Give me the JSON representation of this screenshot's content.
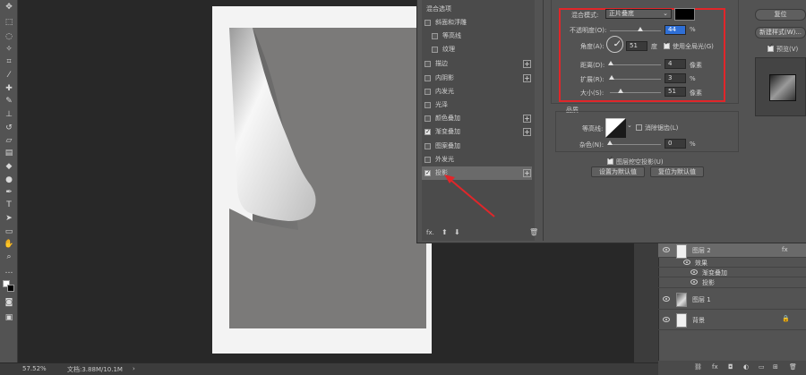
{
  "status": {
    "zoom": "57.52%",
    "doc": "文档:3.88M/10.1M"
  },
  "dialog": {
    "styles": [
      {
        "label": "混合选项",
        "checkbox": false,
        "plus": false,
        "checked": false
      },
      {
        "label": "斜面和浮雕",
        "checkbox": true,
        "plus": false,
        "checked": false
      },
      {
        "label": "等高线",
        "checkbox": true,
        "plus": false,
        "checked": false,
        "sub": true
      },
      {
        "label": "纹理",
        "checkbox": true,
        "plus": false,
        "checked": false,
        "sub": true
      },
      {
        "label": "描边",
        "checkbox": true,
        "plus": true,
        "checked": false
      },
      {
        "label": "内阴影",
        "checkbox": true,
        "plus": true,
        "checked": false
      },
      {
        "label": "内发光",
        "checkbox": true,
        "plus": false,
        "checked": false
      },
      {
        "label": "光泽",
        "checkbox": true,
        "plus": false,
        "checked": false
      },
      {
        "label": "颜色叠加",
        "checkbox": true,
        "plus": true,
        "checked": false
      },
      {
        "label": "渐变叠加",
        "checkbox": true,
        "plus": true,
        "checked": true
      },
      {
        "label": "图案叠加",
        "checkbox": true,
        "plus": false,
        "checked": false
      },
      {
        "label": "外发光",
        "checkbox": true,
        "plus": false,
        "checked": false
      },
      {
        "label": "投影",
        "checkbox": true,
        "plus": true,
        "checked": true,
        "selected": true
      }
    ],
    "fx_label": "fx.",
    "structure": {
      "blend_mode_label": "混合模式:",
      "blend_mode_value": "正片叠底",
      "shadow_color": "#000000",
      "opacity_label": "不透明度(O):",
      "opacity_value": "44",
      "opacity_unit": "%",
      "angle_label": "角度(A):",
      "angle_value": "51",
      "angle_unit": "度",
      "global_light_label": "使用全局光(G)",
      "distance_label": "距离(D):",
      "distance_value": "4",
      "distance_unit": "像素",
      "spread_label": "扩展(R):",
      "spread_value": "3",
      "spread_unit": "%",
      "size_label": "大小(S):",
      "size_value": "51",
      "size_unit": "像素"
    },
    "quality": {
      "section_label": "品质",
      "contour_label": "等高线:",
      "anti_alias_label": "消除锯齿(L)",
      "noise_label": "杂色(N):",
      "noise_value": "0",
      "noise_unit": "%"
    },
    "knockout_label": "图层挖空投影(U)",
    "set_default_label": "设置为默认值",
    "reset_default_label": "复位为默认值",
    "right_buttons": {
      "reset": "复位",
      "new_style": "新建样式(W)...",
      "preview": "预览(V)"
    },
    "accent_red": "#e0262a"
  },
  "layers": {
    "items": [
      {
        "name": "图层 2",
        "fx": "fx"
      },
      {
        "name": "效果",
        "effect": true
      },
      {
        "name": "渐变叠加",
        "effect": true
      },
      {
        "name": "投影",
        "effect": true
      },
      {
        "name": "图层 1"
      },
      {
        "name": "背景"
      }
    ]
  }
}
